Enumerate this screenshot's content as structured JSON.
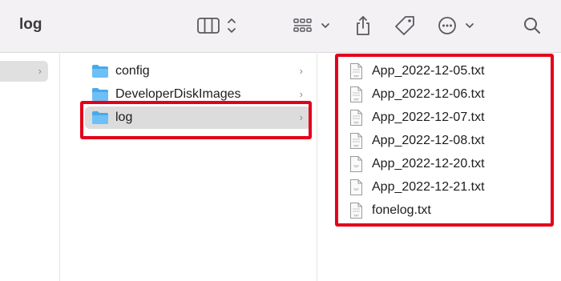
{
  "window": {
    "title": "log"
  },
  "toolbar": {
    "view_icon": "column-view-icon",
    "group_icon": "group-icon",
    "share_icon": "share-icon",
    "tag_icon": "tag-icon",
    "more_icon": "more-icon",
    "search_icon": "search-icon"
  },
  "column1": {
    "chevron": "›"
  },
  "column2": {
    "items": [
      {
        "label": "config",
        "chevron": "›"
      },
      {
        "label": "DeveloperDiskImages",
        "chevron": "›"
      },
      {
        "label": "log",
        "chevron": "›",
        "selected": true
      }
    ]
  },
  "column3": {
    "files": [
      {
        "label": "App_2022-12-05.txt"
      },
      {
        "label": "App_2022-12-06.txt"
      },
      {
        "label": "App_2022-12-07.txt"
      },
      {
        "label": "App_2022-12-08.txt"
      },
      {
        "label": "App_2022-12-20.txt"
      },
      {
        "label": "App_2022-12-21.txt"
      },
      {
        "label": "fonelog.txt"
      }
    ]
  },
  "colors": {
    "highlight": "#e3001b",
    "folder": "#5bb7f0",
    "selection": "#dcdcdc",
    "toolbar_bg": "#f4f1f5"
  }
}
